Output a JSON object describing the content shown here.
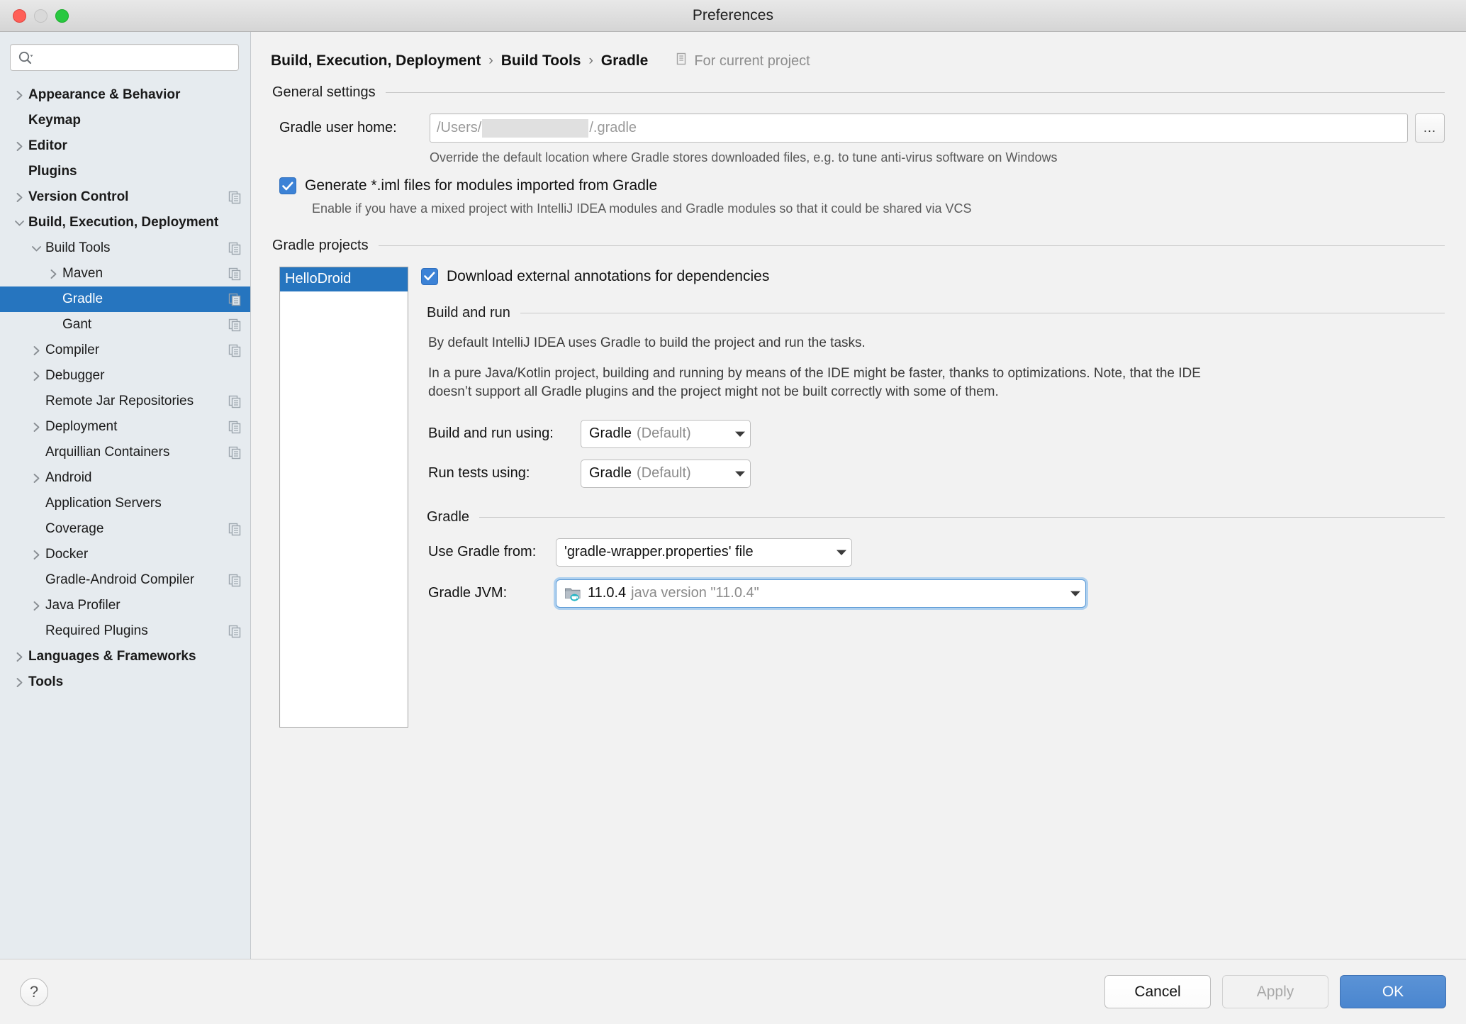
{
  "window": {
    "title": "Preferences"
  },
  "search": {
    "value": "",
    "placeholder": ""
  },
  "sidebar": {
    "items": [
      {
        "label": "Appearance & Behavior",
        "depth": 0,
        "arrow": "right",
        "bold": true,
        "copy": false,
        "selected": false
      },
      {
        "label": "Keymap",
        "depth": 0,
        "arrow": "none",
        "bold": true,
        "copy": false,
        "selected": false
      },
      {
        "label": "Editor",
        "depth": 0,
        "arrow": "right",
        "bold": true,
        "copy": false,
        "selected": false
      },
      {
        "label": "Plugins",
        "depth": 0,
        "arrow": "none",
        "bold": true,
        "copy": false,
        "selected": false
      },
      {
        "label": "Version Control",
        "depth": 0,
        "arrow": "right",
        "bold": true,
        "copy": true,
        "selected": false
      },
      {
        "label": "Build, Execution, Deployment",
        "depth": 0,
        "arrow": "down",
        "bold": true,
        "copy": false,
        "selected": false
      },
      {
        "label": "Build Tools",
        "depth": 1,
        "arrow": "down",
        "bold": false,
        "copy": true,
        "selected": false
      },
      {
        "label": "Maven",
        "depth": 2,
        "arrow": "right",
        "bold": false,
        "copy": true,
        "selected": false
      },
      {
        "label": "Gradle",
        "depth": 2,
        "arrow": "none",
        "bold": false,
        "copy": true,
        "selected": true
      },
      {
        "label": "Gant",
        "depth": 2,
        "arrow": "none",
        "bold": false,
        "copy": true,
        "selected": false
      },
      {
        "label": "Compiler",
        "depth": 1,
        "arrow": "right",
        "bold": false,
        "copy": true,
        "selected": false
      },
      {
        "label": "Debugger",
        "depth": 1,
        "arrow": "right",
        "bold": false,
        "copy": false,
        "selected": false
      },
      {
        "label": "Remote Jar Repositories",
        "depth": 1,
        "arrow": "none",
        "bold": false,
        "copy": true,
        "selected": false
      },
      {
        "label": "Deployment",
        "depth": 1,
        "arrow": "right",
        "bold": false,
        "copy": true,
        "selected": false
      },
      {
        "label": "Arquillian Containers",
        "depth": 1,
        "arrow": "none",
        "bold": false,
        "copy": true,
        "selected": false
      },
      {
        "label": "Android",
        "depth": 1,
        "arrow": "right",
        "bold": false,
        "copy": false,
        "selected": false
      },
      {
        "label": "Application Servers",
        "depth": 1,
        "arrow": "none",
        "bold": false,
        "copy": false,
        "selected": false
      },
      {
        "label": "Coverage",
        "depth": 1,
        "arrow": "none",
        "bold": false,
        "copy": true,
        "selected": false
      },
      {
        "label": "Docker",
        "depth": 1,
        "arrow": "right",
        "bold": false,
        "copy": false,
        "selected": false
      },
      {
        "label": "Gradle-Android Compiler",
        "depth": 1,
        "arrow": "none",
        "bold": false,
        "copy": true,
        "selected": false
      },
      {
        "label": "Java Profiler",
        "depth": 1,
        "arrow": "right",
        "bold": false,
        "copy": false,
        "selected": false
      },
      {
        "label": "Required Plugins",
        "depth": 1,
        "arrow": "none",
        "bold": false,
        "copy": true,
        "selected": false
      },
      {
        "label": "Languages & Frameworks",
        "depth": 0,
        "arrow": "right",
        "bold": true,
        "copy": false,
        "selected": false
      },
      {
        "label": "Tools",
        "depth": 0,
        "arrow": "right",
        "bold": true,
        "copy": false,
        "selected": false
      }
    ]
  },
  "header": {
    "crumb1": "Build, Execution, Deployment",
    "crumb2": "Build Tools",
    "crumb3": "Gradle",
    "separator": "›",
    "for_current_project": "For current project"
  },
  "general_settings": {
    "title": "General settings",
    "gradle_user_home_label": "Gradle user home:",
    "gradle_user_home_prefix": "/Users/",
    "gradle_user_home_suffix": "/.gradle",
    "browse_button": "...",
    "gradle_user_home_hint": "Override the default location where Gradle stores downloaded files, e.g. to tune anti-virus software on Windows",
    "generate_iml_label": "Generate *.iml files for modules imported from Gradle",
    "generate_iml_checked": true,
    "generate_iml_hint": "Enable if you have a mixed project with IntelliJ IDEA modules and Gradle modules so that it could be shared via VCS"
  },
  "gradle_projects": {
    "title": "Gradle projects",
    "projects": [
      "HelloDroid"
    ],
    "selected_project": "HelloDroid",
    "download_annotations_label": "Download external annotations for dependencies",
    "download_annotations_checked": true
  },
  "build_and_run": {
    "title": "Build and run",
    "paragraph1": "By default IntelliJ IDEA uses Gradle to build the project and run the tasks.",
    "paragraph2": "In a pure Java/Kotlin project, building and running by means of the IDE might be faster, thanks to optimizations. Note, that the IDE doesn’t support all Gradle plugins and the project might not be built correctly with some of them.",
    "build_run_using_label": "Build and run using:",
    "build_run_using_value": "Gradle",
    "build_run_using_suffix": "(Default)",
    "run_tests_using_label": "Run tests using:",
    "run_tests_using_value": "Gradle",
    "run_tests_using_suffix": "(Default)"
  },
  "gradle_section": {
    "title": "Gradle",
    "use_gradle_from_label": "Use Gradle from:",
    "use_gradle_from_value": "'gradle-wrapper.properties' file",
    "gradle_jvm_label": "Gradle JVM:",
    "gradle_jvm_value": "11.0.4",
    "gradle_jvm_suffix": "java version \"11.0.4\""
  },
  "footer": {
    "help": "?",
    "cancel": "Cancel",
    "apply": "Apply",
    "ok": "OK"
  },
  "colors": {
    "selection_blue": "#2675bf",
    "checkbox_blue": "#3c82d6",
    "primary_button": "#4a86cf",
    "focus_ring": "#aed0ef"
  }
}
